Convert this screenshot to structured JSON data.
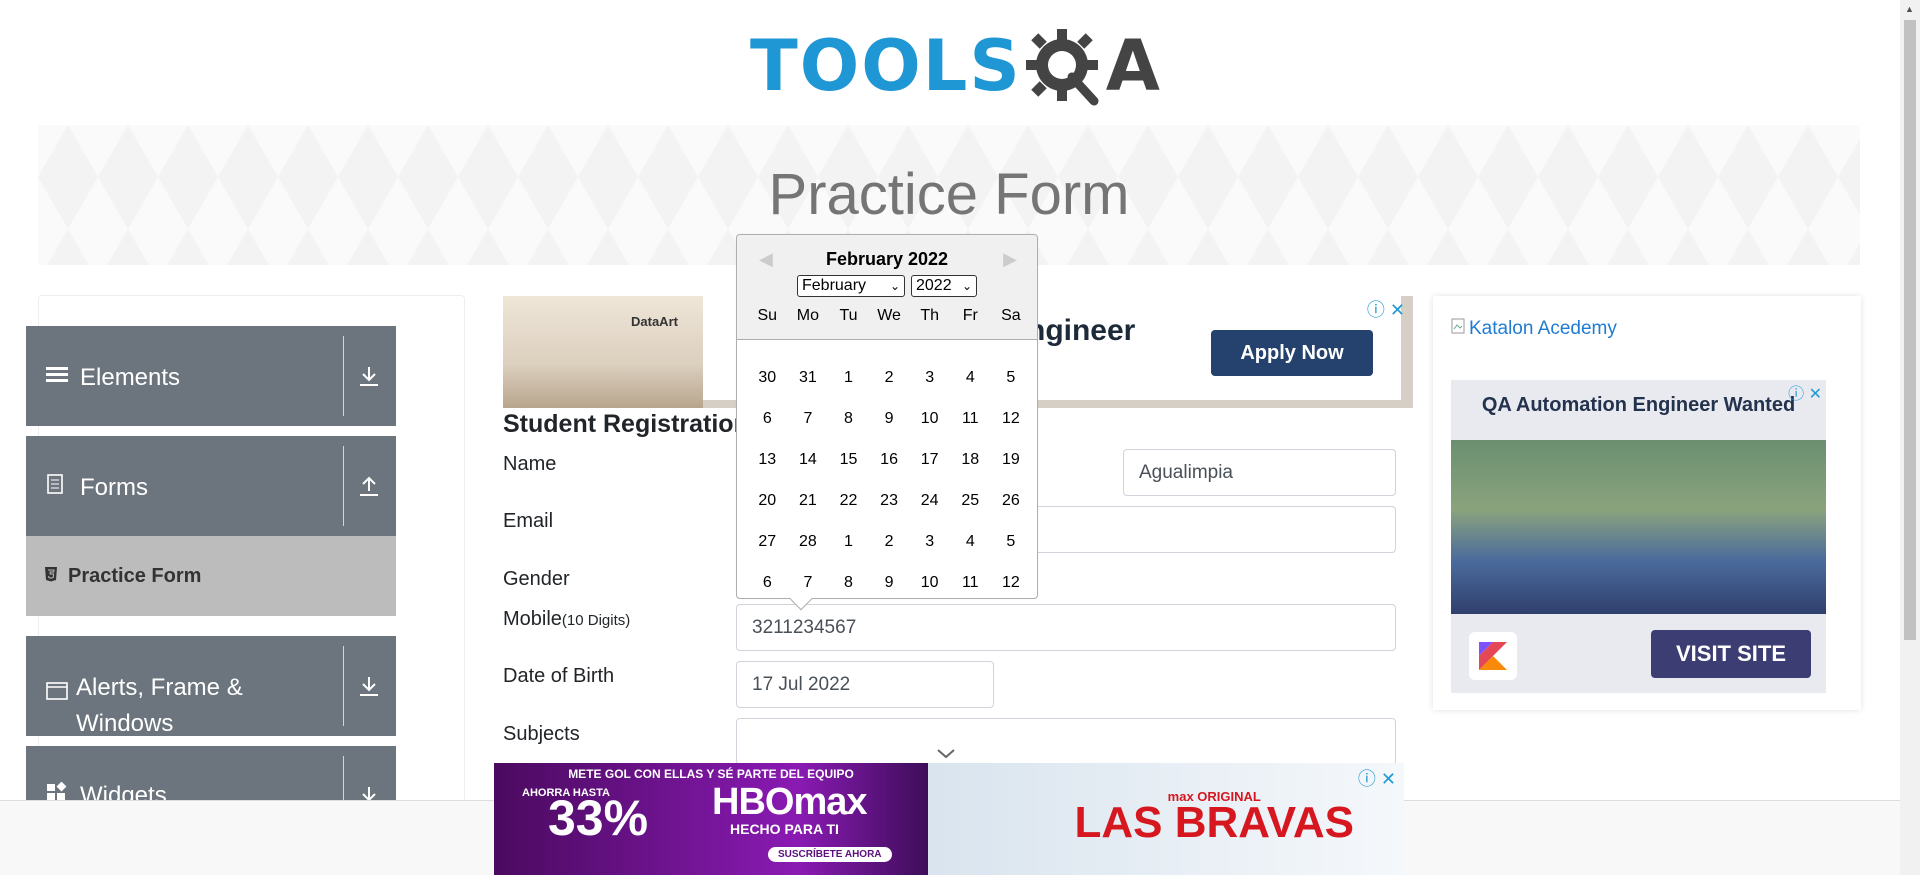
{
  "header": {
    "logo_text": "TOOLS",
    "logo_qa": "A"
  },
  "banner": {
    "title": "Practice Form"
  },
  "sidebar": {
    "groups": [
      {
        "label": "Elements",
        "icon": "hamburger-icon",
        "arrow": "download-icon"
      },
      {
        "label": "Forms",
        "icon": "document-icon",
        "arrow": "upload-icon"
      },
      {
        "label": "Alerts, Frame & Windows",
        "icon": "window-icon",
        "arrow": "download-icon"
      },
      {
        "label": "Widgets",
        "icon": "widgets-icon",
        "arrow": "download-icon"
      }
    ],
    "active_item": "Practice Form"
  },
  "ad_top": {
    "headline": "ngineer",
    "button": "Apply Now",
    "brand": "DataArt"
  },
  "form": {
    "title": "Student Registration",
    "name_label": "Name",
    "last_name_value": "Agualimpia",
    "email_label": "Email",
    "gender_label": "Gender",
    "mobile_label": "Mobile",
    "mobile_hint": "(10 Digits)",
    "mobile_value": "3211234567",
    "dob_label": "Date of Birth",
    "dob_value": "17 Jul 2022",
    "subjects_label": "Subjects"
  },
  "datepicker": {
    "month_year": "February 2022",
    "month_select": "February",
    "year_select": "2022",
    "weekdays": [
      "Su",
      "Mo",
      "Tu",
      "We",
      "Th",
      "Fr",
      "Sa"
    ],
    "weeks": [
      [
        "30",
        "31",
        "1",
        "2",
        "3",
        "4",
        "5"
      ],
      [
        "6",
        "7",
        "8",
        "9",
        "10",
        "11",
        "12"
      ],
      [
        "13",
        "14",
        "15",
        "16",
        "17",
        "18",
        "19"
      ],
      [
        "20",
        "21",
        "22",
        "23",
        "24",
        "25",
        "26"
      ],
      [
        "27",
        "28",
        "1",
        "2",
        "3",
        "4",
        "5"
      ],
      [
        "6",
        "7",
        "8",
        "9",
        "10",
        "11",
        "12"
      ]
    ]
  },
  "right_ad": {
    "broken_image_text": "Katalon Acedemy",
    "title": "QA Automation Engineer Wanted",
    "button": "VISIT SITE"
  },
  "bottom_ad": {
    "tagline": "METE GOL CON ELLAS Y SÉ PARTE DEL EQUIPO",
    "pre": "AHORRA HASTA",
    "percent": "33%",
    "brand": "HBOmax",
    "sub": "HECHO PARA TI",
    "cta": "SUSCRÍBETE AHORA",
    "show_small": "max ORIGINAL",
    "show_title": "LAS BRAVAS"
  }
}
